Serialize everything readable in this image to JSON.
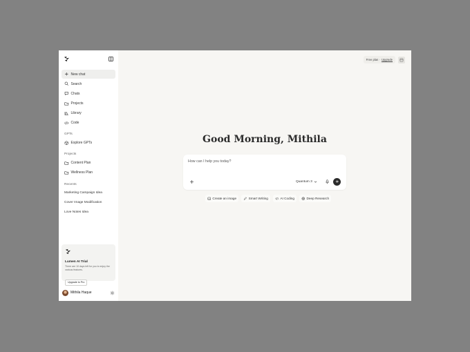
{
  "sidebar": {
    "nav": [
      {
        "label": "New chat",
        "icon": "plus-icon"
      },
      {
        "label": "Search",
        "icon": "search-icon"
      },
      {
        "label": "Chats",
        "icon": "chat-bubble-icon"
      },
      {
        "label": "Projects",
        "icon": "folder-icon"
      },
      {
        "label": "Library",
        "icon": "library-icon"
      },
      {
        "label": "Code",
        "icon": "code-icon"
      }
    ],
    "gpts_label": "GPTs",
    "explore_gpts": "Explore GPTs",
    "projects_label": "Projects",
    "projects": [
      "Content Plan",
      "Wellness Plan"
    ],
    "recents_label": "Recents",
    "recents": [
      "Marketing Campaign Idea",
      "Cover Image Modification",
      "Love Notes Idea"
    ],
    "trial": {
      "title": "Lumen AI Trial",
      "text": "There are 10 days left for you to enjoy the various features.",
      "button": "Upgrade to Pro"
    },
    "profile_name": "Mithila Haque"
  },
  "header": {
    "plan_text": "Free plan ·",
    "upgrade_link": "Upgrade"
  },
  "main": {
    "greeting": "Good Morning, Mithila",
    "input_placeholder": "How can I help you today?",
    "model": "Quantum 3",
    "chips": [
      {
        "label": "Create an image",
        "icon": "image-icon"
      },
      {
        "label": "Smart Writing",
        "icon": "pen-icon"
      },
      {
        "label": "AI Coding",
        "icon": "code-icon"
      },
      {
        "label": "Deep Research",
        "icon": "globe-icon"
      }
    ]
  },
  "colors": {
    "backdrop": "#828282",
    "canvas": "#f7f6f3",
    "sidebar": "#ffffff",
    "send_button": "#2c2c2c"
  }
}
